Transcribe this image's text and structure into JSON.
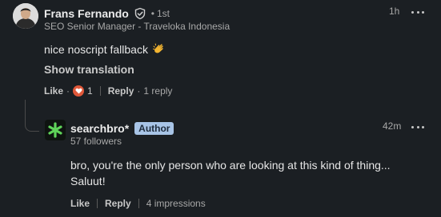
{
  "comment": {
    "author_name": "Frans Fernando",
    "degree_separator": "•",
    "degree": "1st",
    "headline": "SEO Senior Manager - Traveloka Indonesia",
    "time": "1h",
    "text": "nice noscript fallback",
    "show_translation_label": "Show translation",
    "like_label": "Like",
    "reaction_count": "1",
    "reply_label": "Reply",
    "replies_count_label": "1 reply"
  },
  "reply": {
    "author_name": "searchbro*",
    "badge": "Author",
    "followers": "57 followers",
    "time": "42m",
    "text": "bro, you're the only person who are looking at this kind of thing... Saluut!",
    "like_label": "Like",
    "reply_label": "Reply",
    "impressions": "4 impressions"
  },
  "separators": {
    "dot": "·"
  },
  "icons": {
    "verified": "verified-shield-icon",
    "clap": "clapping-hands-icon",
    "heart": "love-reaction-icon",
    "more": "more-options-icon",
    "logo": "green-asterisk-logo"
  },
  "colors": {
    "background": "#1b1f23",
    "author_badge": "#a8c4e6",
    "logo_green": "#5fd35a",
    "heart_reaction": "#e0583a"
  }
}
